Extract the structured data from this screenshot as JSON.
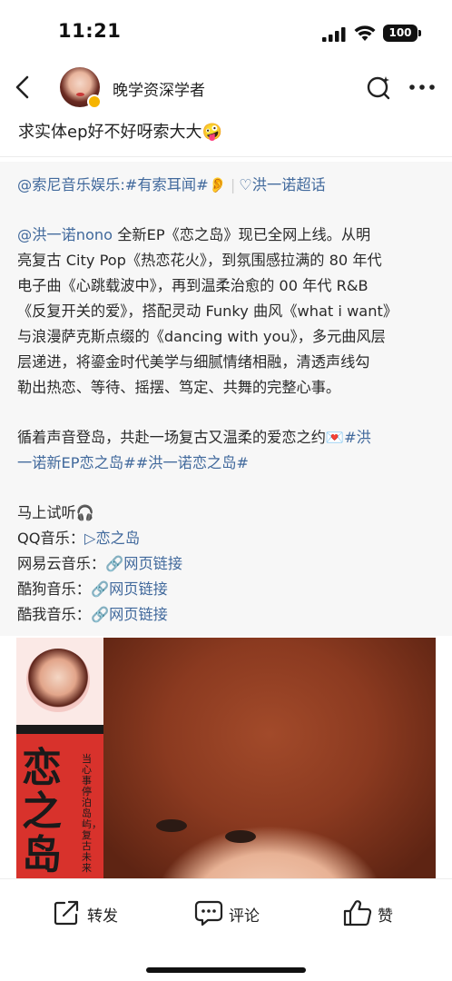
{
  "status_bar": {
    "time": "11:21",
    "battery": "100"
  },
  "header": {
    "username": "晚学资深学者"
  },
  "comment_title": "求实体ep好不好呀索大大🤪",
  "post": {
    "line1": {
      "mention": "@索尼音乐娱乐",
      "topic": ":#有索耳闻#👂",
      "super_topic": "♡洪一诺超话"
    },
    "para1": {
      "mention": "@洪一诺nono",
      "l1": " 全新EP《恋之岛》现已全网上线。从明",
      "l2": "亮复古 City Pop《热恋花火》，到氛围感拉满的 80 年代",
      "l3": "电子曲《心跳载波中》，再到温柔治愈的 00 年代 R&B",
      "l4": "《反复开关的爱》，搭配灵动 Funky 曲风《what i want》",
      "l5": "与浪漫萨克斯点缀的《dancing with you》，多元曲风层",
      "l6": "层递进，将鎏金时代美学与细腻情绪相融，清透声线勾",
      "l7": "勒出热恋、等待、摇摆、笃定、共舞的完整心事。"
    },
    "para2": {
      "text": "循着声音登岛，共赴一场复古又温柔的爱恋之约💌",
      "tag1": "#洪",
      "tag1_cont": "一诺新EP恋之岛#",
      "tag2": "#洪一诺恋之岛#"
    },
    "listen": {
      "title": "马上试听🎧",
      "qq_label": "QQ音乐：",
      "qq_link": "▷恋之岛",
      "netease_label": "网易云音乐：",
      "kugou_label": "酷狗音乐：",
      "kuwo_label": "酷我音乐：",
      "web_link": "🔗网页链接"
    },
    "cover": {
      "title": "恋之岛",
      "vertical_text": "当心事停泊岛屿，复古未来"
    }
  },
  "actions": {
    "repost": "转发",
    "comment": "评论",
    "like": "赞"
  }
}
